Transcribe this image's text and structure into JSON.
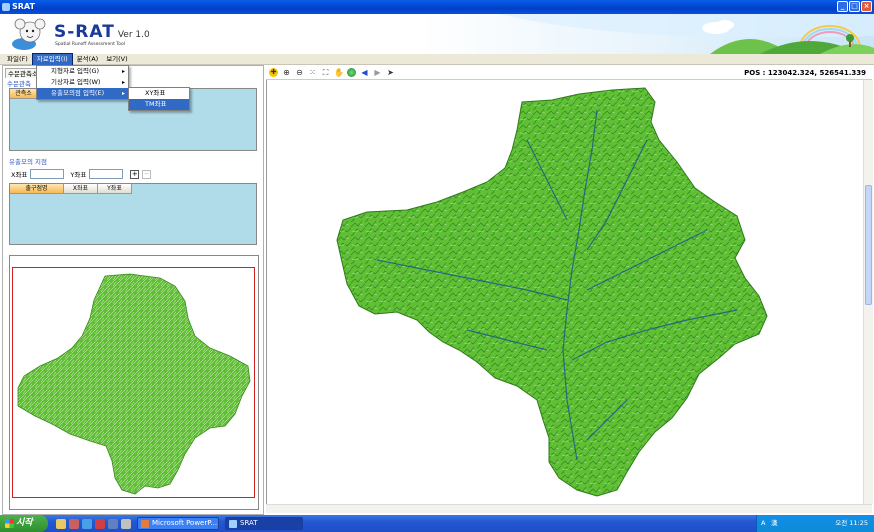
{
  "window": {
    "title": "SRAT"
  },
  "banner": {
    "logo": "S-RAT",
    "version": "Ver 1.0",
    "subtitle": "Spatial Runoff Assessment Tool"
  },
  "menu": {
    "file": "파일(F)",
    "input": "자료입력(I)",
    "analysis": "분석(A)",
    "view": "보기(V)"
  },
  "dropdown": {
    "items": [
      "지형자료 입력(G)",
      "기상자료 입력(W)",
      "유출모의점 입력(E)"
    ],
    "submenu": [
      "XY좌표",
      "TM좌표"
    ]
  },
  "left": {
    "tab_label": "수문관측소",
    "station_group": "수문관측",
    "station_col": "관측소",
    "sim_group": "유출모의 지점",
    "x_label": "X좌표",
    "y_label": "Y좌표",
    "x_value": "",
    "y_value": "",
    "add": "+",
    "remove": "−",
    "columns": [
      "출구점명",
      "X좌표",
      "Y좌표"
    ]
  },
  "toolbar": {
    "icons": [
      "add-layer-icon",
      "zoom-in-icon",
      "zoom-out-icon",
      "full-extent-icon",
      "zoom-extent-icon",
      "pan-hand-icon",
      "globe-icon",
      "back-arrow-icon",
      "forward-arrow-icon",
      "select-pointer-icon"
    ],
    "pos": "POS : 123042.324, 526541.339"
  },
  "map": {
    "fill_color": "#5ec032",
    "stream_color": "#1f5a8c",
    "outline_color": "#2e7a1a"
  },
  "taskbar": {
    "start": "시작",
    "tasks": [
      "Microsoft PowerP...",
      "SRAT"
    ],
    "tray_left": "A",
    "tray_ime": "漢",
    "clock": "오전 11:25"
  },
  "colors": {
    "titlebar": "#0a5de8",
    "menu_highlight": "#316ac5",
    "list_bg": "#b0dcea",
    "group_text": "#2a56c8"
  }
}
